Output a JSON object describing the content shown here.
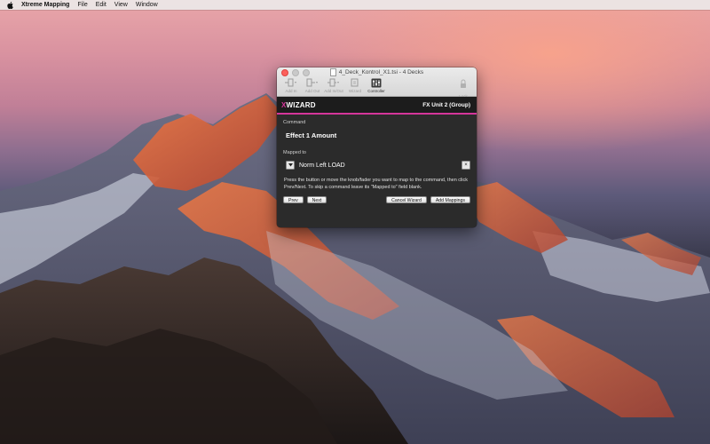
{
  "menubar": {
    "app_name": "Xtreme Mapping",
    "items": [
      "File",
      "Edit",
      "View",
      "Window"
    ]
  },
  "window": {
    "title": "4_Deck_Kontrol_X1.tsi - 4 Decks",
    "toolbar": [
      {
        "label": "Add In",
        "icon": "add-in-icon",
        "active": false
      },
      {
        "label": "Add Out",
        "icon": "add-out-icon",
        "active": false
      },
      {
        "label": "Add In/Out",
        "icon": "add-in-out-icon",
        "active": false
      },
      {
        "label": "Wizard",
        "icon": "wizard-icon",
        "active": false
      },
      {
        "label": "Controller",
        "icon": "controller-icon",
        "active": true
      }
    ],
    "lock_label": "Lock"
  },
  "wizard": {
    "brand_x": "X",
    "brand_rest": "WIZARD",
    "group": "FX Unit 2 (Group)",
    "command_label": "Command",
    "command_value": "Effect 1 Amount",
    "mapped_label": "Mapped to",
    "mapped_value": "Norm Left LOAD",
    "clear_symbol": "×",
    "instructions": "Press the button or move the knob/fader you want to map to the command, then click Prev/Next. To skip a command leave its \"Mapped to\" field blank.",
    "buttons": {
      "prev": "Prev",
      "next": "Next",
      "cancel": "Cancel Wizard",
      "add": "Add Mappings"
    }
  },
  "colors": {
    "accent": "#d4359a",
    "panel": "#2b2b2b",
    "header": "#1c1c1c"
  }
}
